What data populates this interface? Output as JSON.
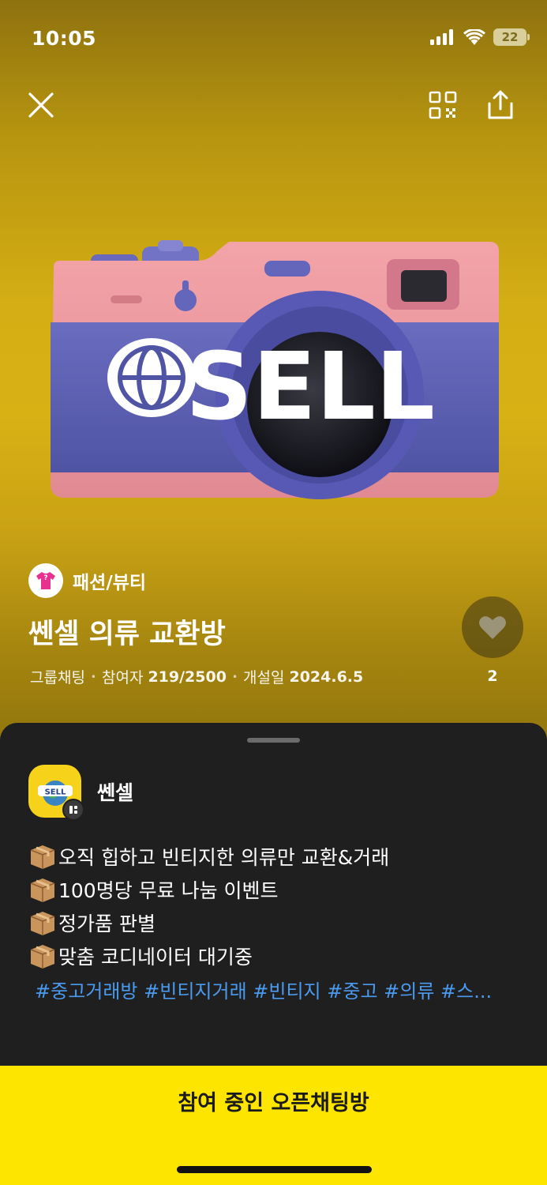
{
  "status_bar": {
    "time": "10:05",
    "battery": "22"
  },
  "category": {
    "label": "패션/뷰티"
  },
  "room": {
    "title": "쎈셀 의류 교환방",
    "type": "그룹채팅",
    "participants_label": "참여자",
    "participants": "219/2500",
    "opened_label": "개설일",
    "opened": "2024.6.5",
    "likes": "2"
  },
  "cover": {
    "logo_text": "SELL"
  },
  "host": {
    "name": "쎈셀",
    "avatar_text": "SELL"
  },
  "description": {
    "lines": [
      "오직 힙하고 빈티지한 의류만 교환&거래",
      "100명당 무료 나눔 이벤트",
      "정가품 판별",
      "맞춤 코디네이터 대기중"
    ],
    "tags": "#중고거래방 #빈티지거래 #빈티지 #중고 #의류 #스..."
  },
  "join_button": {
    "label": "참여 중인 오픈채팅방"
  },
  "colors": {
    "accent": "#fee500",
    "tag": "#4a9bf0",
    "sheet": "#1f1f1f"
  }
}
